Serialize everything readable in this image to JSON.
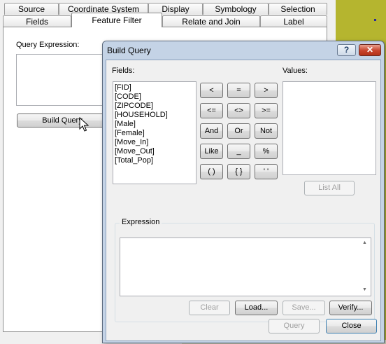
{
  "properties_dialog": {
    "tabs_back": [
      "Source",
      "Coordinate System",
      "Display",
      "Symbology",
      "Selection"
    ],
    "tabs_front": [
      "Fields",
      "Feature Filter",
      "Relate and Join",
      "Label"
    ],
    "active_tab": "Feature Filter",
    "query_expression_label": "Query Expression:",
    "query_expression_value": "",
    "build_query_button": "Build Query"
  },
  "build_query": {
    "title": "Build Query",
    "help_glyph": "?",
    "close_glyph": "✕",
    "fields_label": "Fields:",
    "fields": [
      "[FID]",
      "[CODE]",
      "[ZIPCODE]",
      "[HOUSEHOLD]",
      "[Male]",
      "[Female]",
      "[Move_In]",
      "[Move_Out]",
      "[Total_Pop]"
    ],
    "operators": [
      [
        "<",
        "=",
        ">"
      ],
      [
        "<=",
        "<>",
        ">="
      ],
      [
        "And",
        "Or",
        "Not"
      ],
      [
        "Like",
        "_",
        "%"
      ],
      [
        "( )",
        "{ }",
        "' '"
      ]
    ],
    "values_label": "Values:",
    "list_all_button": "List All",
    "expression_label": "Expression",
    "expression_value": "",
    "clear_button": "Clear",
    "load_button": "Load...",
    "save_button": "Save...",
    "verify_button": "Verify...",
    "query_button": "Query",
    "close_button": "Close"
  }
}
